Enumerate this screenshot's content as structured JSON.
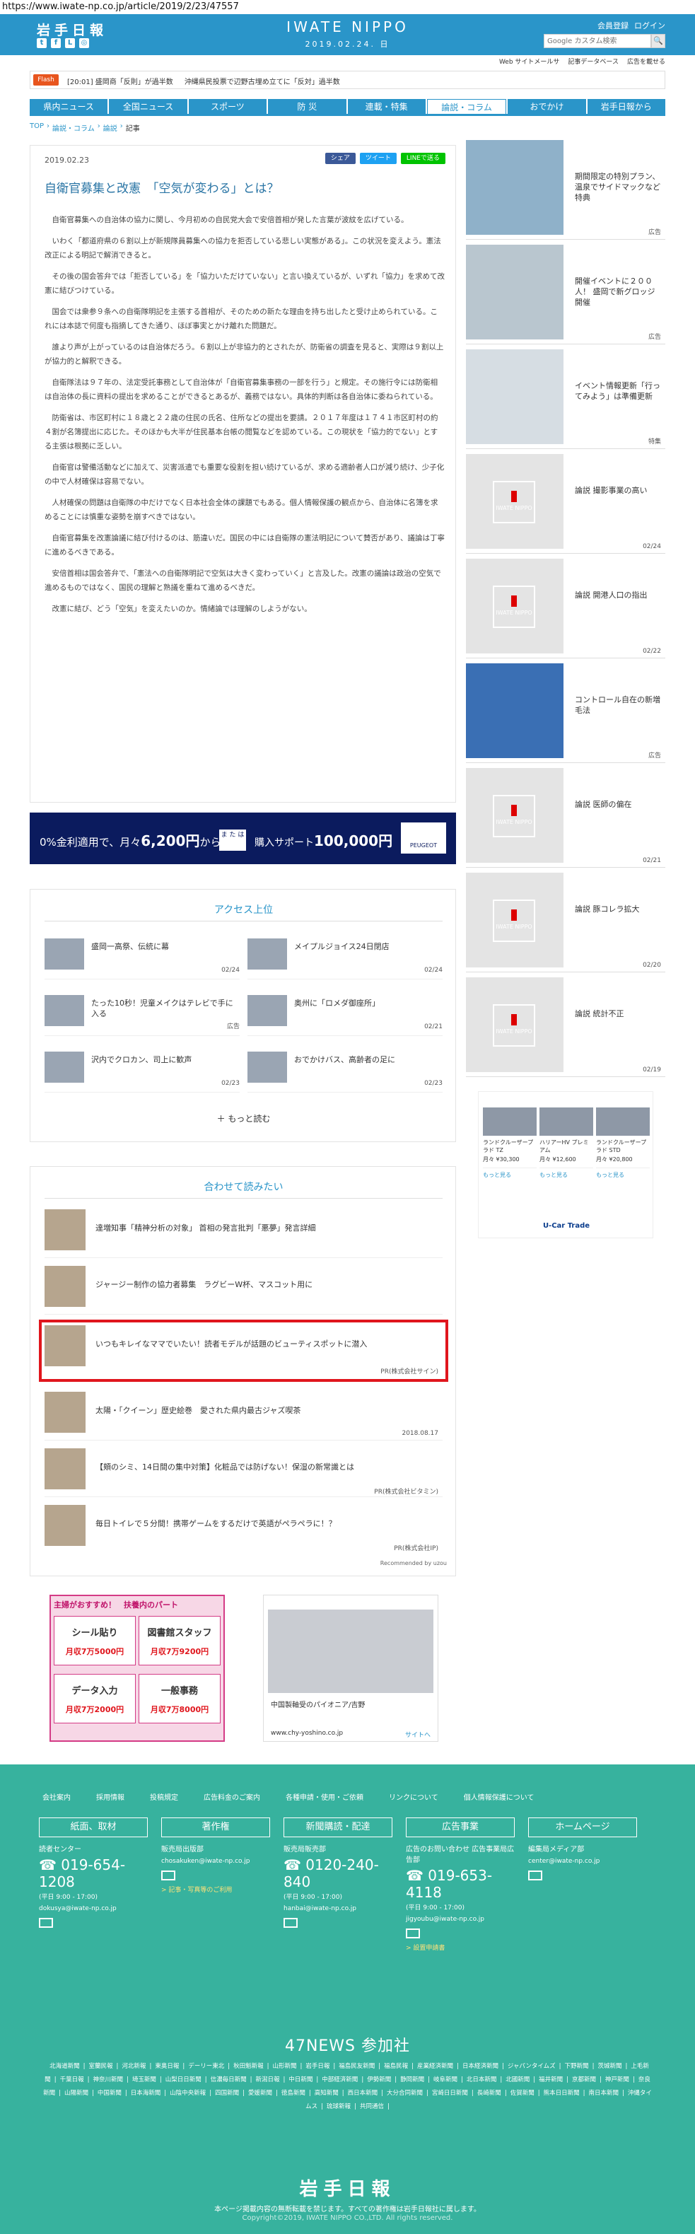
{
  "url": "https://www.iwate-np.co.jp/article/2019/2/23/47557",
  "header": {
    "logo": "岩手日報",
    "brand": "IWATE NIPPO",
    "date": "2019.02.24. 日",
    "member_register": "会員登録",
    "login": "ログイン",
    "search_placeholder": "Google カスタム検索",
    "search_button": "🔍"
  },
  "sublinks": [
    "Web サイトメールサ",
    "記事データベース",
    "広告を載せる"
  ],
  "flash": {
    "tag": "Flash",
    "items": [
      "[20:01] 盛岡商「反則」が過半数",
      "沖縄県民投票で辺野古埋め立てに「反対」過半数"
    ]
  },
  "nav": [
    "県内ニュース",
    "全国ニュース",
    "スポーツ",
    "防 災",
    "連載・特集",
    "論説・コラム",
    "おでかけ",
    "岩手日報から"
  ],
  "breadcrumb": [
    "TOP",
    "論説・コラム",
    "論説",
    "記事"
  ],
  "article": {
    "date": "2019.02.23",
    "share": [
      "シェア",
      "ツイート",
      "LINEで送る"
    ],
    "title": "自衛官募集と改憲　「空気が変わる」とは？",
    "paragraphs": [
      "自衛官募集への自治体の協力に関し、今月初めの自民党大会で安倍首相が発した言葉が波紋を広げている。",
      "いわく「都道府県の６割以上が新規隊員募集への協力を拒否している悲しい実態がある」。この状況を変えよう。憲法改正による明記で解消できると。",
      "その後の国会答弁では「拒否している」を「協力いただけていない」と言い換えているが、いずれ「協力」を求めて改憲に結びつけている。",
      "国会では衆参９条への自衛隊明記を主張する首相が、そのための新たな理由を持ち出したと受け止められている。これには本誌で何度も指摘してきた通り、ほぼ事実とかけ離れた問題だ。",
      "誰より声が上がっているのは自治体だろう。６割以上が非協力的とされたが、防衛省の調査を見ると、実際は９割以上が協力的と解釈できる。",
      "自衛隊法は９７年の、法定受託事務として自治体が「自衛官募集事務の一部を行う」と規定。その施行令には防衛相は自治体の長に資料の提出を求めることができるとあるが、義務ではない。具体的判断は各自治体に委ねられている。",
      "防衛省は、市区町村に１８歳と２２歳の住民の氏名、住所などの提出を要請。２０１７年度は１７４１市区町村の約４割が名簿提出に応じた。そのほかも大半が住民基本台帳の閲覧などを認めている。この現状を「協力的でない」とする主張は根拠に乏しい。",
      "自衛官は警備活動などに加えて、災害派遣でも重要な役割を担い続けているが、求める適齢者人口が減り続け、少子化の中で人材確保は容易でない。",
      "人材確保の問題は自衛隊の中だけでなく日本社会全体の課題でもある。個人情報保護の観点から、自治体に名簿を求めることには慎重な姿勢を崩すべきではない。",
      "自衛官募集を改憲論議に結び付けるのは、筋違いだ。国民の中には自衛隊の憲法明記について賛否があり、議論は丁寧に進めるべきである。",
      "安倍首相は国会答弁で、「憲法への自衛隊明記で空気は大きく変わっていく」と言及した。改憲の議論は政治の空気で進めるものではなく、国民の理解と熟議を重ねて進めるべきだ。",
      "改憲に結び、どう「空気」を変えたいのか。情緒論では理解のしようがない。"
    ]
  },
  "banner_ad": {
    "left": "0%金利適用で、月々",
    "amount": "6,200円",
    "from": "から",
    "box": "ま た は",
    "right": "購入サポート",
    "amount2": "100,000円",
    "logo": "PEUGEOT"
  },
  "access": {
    "title": "アクセス上位",
    "items": [
      {
        "title": "盛岡一高祭、伝統に幕",
        "date": "02/24"
      },
      {
        "title": "メイプルジョイス24日閉店",
        "date": "02/24"
      },
      {
        "title": "たった10秒！児童メイクはテレビで手に入る",
        "date": "広告"
      },
      {
        "title": "奥州に「ロメダ御座所」",
        "date": "02/21"
      },
      {
        "title": "沢内でクロカン、司上に歓声",
        "date": "02/23"
      },
      {
        "title": "おでかけバス、高齢者の足に",
        "date": "02/23"
      }
    ],
    "more": "もっと読む"
  },
  "reco": {
    "title": "合わせて読みたい",
    "items": [
      {
        "title": "達増知事「精神分析の対象」 首相の発言批判「悪夢」発言詳細",
        "meta": ""
      },
      {
        "title": "ジャージー制作の協力者募集　ラグビーW杯、マスコット用に",
        "meta": ""
      },
      {
        "title": "いつもキレイなママでいたい！読者モデルが話題のビューティスポットに潜入",
        "meta": "PR(株式会社サイン)"
      },
      {
        "title": "太陽・「クイーン」歴史絵巻　愛された県内最古ジャズ喫茶",
        "meta": "2018.08.17"
      },
      {
        "title": "【頬のシミ、14日間の集中対策】化粧品では防げない！保湿の新常識とは",
        "meta": "PR(株式会社ビタミン)"
      },
      {
        "title": "毎日トイレで５分間！携帯ゲームをするだけで英語がペラペラに！？",
        "meta": "PR(株式会社IP)"
      }
    ],
    "powered": "Recommended by uzou"
  },
  "jobs_ad": {
    "head": "主婦がおすすめ！　扶養内のパート",
    "cells": [
      {
        "role": "シール貼り",
        "pay": "月収7万5000円"
      },
      {
        "role": "図書館スタッフ",
        "pay": "月収7万9200円"
      },
      {
        "role": "データ入力",
        "pay": "月収7万2000円"
      },
      {
        "role": "一般事務",
        "pay": "月収7万8000円"
      }
    ]
  },
  "bear_ad": {
    "caption": "中国製軸受のパイオニア/吉野",
    "url": "www.chy-yoshino.co.jp",
    "site": "サイトへ"
  },
  "sidebar": [
    {
      "text": "期間限定の特別プラン、温泉でサイドマックなど特典",
      "pr": "広告",
      "img": "photo"
    },
    {
      "text": "開催イベントに２００人！ 盛岡で新グロッジ開催",
      "pr": "広告",
      "img": "photo"
    },
    {
      "text": "イベント情報更新「行ってみよう」は準備更新",
      "pr": "特集",
      "img": "photo"
    },
    {
      "text": "論説 撮影事業の高い",
      "pr": "02/24",
      "img": "mark"
    },
    {
      "text": "論説 開港人口の指出",
      "pr": "02/22",
      "img": "mark"
    },
    {
      "text": "コントロール自在の新増毛法",
      "pr": "広告",
      "img": "photo"
    },
    {
      "text": "論説 医師の偏在",
      "pr": "02/21",
      "img": "mark"
    },
    {
      "text": "論説 豚コレラ拡大",
      "pr": "02/20",
      "img": "mark"
    },
    {
      "text": "論説 統計不正",
      "pr": "02/19",
      "img": "mark"
    }
  ],
  "car_ad": {
    "cars": [
      {
        "name": "ランドクルーザープラド TZ",
        "price": "月々 ¥30,300"
      },
      {
        "name": "ハリアーHV プレミアム",
        "price": "月々 ¥12,600"
      },
      {
        "name": "ランドクルーザープラド STD",
        "price": "月々 ¥20,800"
      }
    ],
    "brand": "U-Car Trade",
    "btn": "もっと見る"
  },
  "footer": {
    "links": [
      "会社案内",
      "採用情報",
      "投稿規定",
      "広告料金のご案内",
      "各種申請・使用・ご依頼",
      "リンクについて",
      "個人情報保護について"
    ],
    "cols": [
      {
        "head": "紙面、取材",
        "l1": "読者センター",
        "tel": "019-654-1208",
        "l2": "(平日 9:00 - 17:00)",
        "mail": "dokusya@iwate-np.co.jp",
        "lnk": ""
      },
      {
        "head": "著作権",
        "l1": "販売局出版部",
        "tel": "",
        "l2": "",
        "mail": "chosakuken@iwate-np.co.jp",
        "lnk": "> 記事・写真等のご利用"
      },
      {
        "head": "新聞購読・配達",
        "l1": "販売局販売部",
        "tel": "0120-240-840",
        "l2": "(平日 9:00 - 17:00)",
        "mail": "hanbai@iwate-np.co.jp",
        "lnk": ""
      },
      {
        "head": "広告事業",
        "l1": "広告のお問い合わせ 広告事業局広告部",
        "tel": "019-653-4118",
        "l2": "(平日 9:00 - 17:00)",
        "mail": "jigyoubu@iwate-np.co.jp",
        "lnk": "> 設置申請書"
      },
      {
        "head": "ホームページ",
        "l1": "編集局メディア部",
        "tel": "",
        "l2": "",
        "mail": "center@iwate-np.co.jp",
        "lnk": ""
      }
    ],
    "n47": "47NEWS 参加社",
    "members": [
      "北海道新聞",
      "室蘭民報",
      "河北新報",
      "東奥日報",
      "デーリー東北",
      "秋田魁新報",
      "山形新聞",
      "岩手日報",
      "福島民友新聞",
      "福島民報",
      "産業経済新聞",
      "日本経済新聞",
      "ジャパンタイムズ",
      "下野新聞",
      "茨城新聞",
      "上毛新聞",
      "千葉日報",
      "神奈川新聞",
      "埼玉新聞",
      "山梨日日新聞",
      "信濃毎日新聞",
      "新潟日報",
      "中日新聞",
      "中部経済新聞",
      "伊勢新聞",
      "静岡新聞",
      "岐阜新聞",
      "北日本新聞",
      "北國新聞",
      "福井新聞",
      "京都新聞",
      "神戸新聞",
      "奈良新聞",
      "山陽新聞",
      "中国新聞",
      "日本海新聞",
      "山陰中央新報",
      "四国新聞",
      "愛媛新聞",
      "徳島新聞",
      "高知新聞",
      "西日本新聞",
      "大分合同新聞",
      "宮崎日日新聞",
      "長崎新聞",
      "佐賀新聞",
      "熊本日日新聞",
      "南日本新聞",
      "沖縄タイムス",
      "琉球新報",
      "共同通信"
    ],
    "logo": "岩手日報",
    "note": "本ページ掲載内容の無断転載を禁じます。すべての著作権は岩手日報社に属します。",
    "copy": "Copyright©2019, IWATE NIPPO CO.,LTD. All rights reserved."
  }
}
